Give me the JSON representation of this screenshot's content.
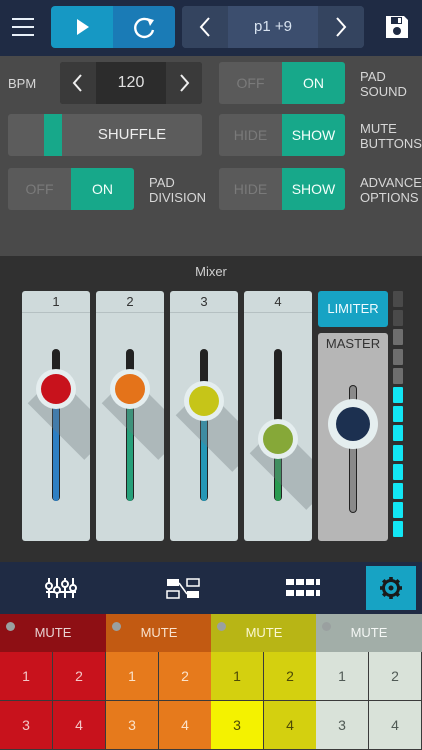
{
  "topbar": {
    "preset_name": "p1 +9",
    "menu_icon": "hamburger-menu-icon",
    "play_icon": "play-icon",
    "repeat_icon": "repeat-icon",
    "prev_icon": "chevron-left-icon",
    "next_icon": "chevron-right-icon",
    "save_icon": "floppy-disk-icon"
  },
  "settings": {
    "bpm_label": "BPM",
    "bpm_value": "120",
    "shuffle_label": "SHUFFLE",
    "shuffle_amount": 0.2,
    "pad_division": {
      "label_line1": "PAD",
      "label_line2": "DIVISION",
      "off": "OFF",
      "on": "ON",
      "value": "ON"
    },
    "pad_sound": {
      "label_line1": "PAD",
      "label_line2": "SOUND",
      "off": "OFF",
      "on": "ON",
      "value": "ON"
    },
    "mute_buttons": {
      "label_line1": "MUTE",
      "label_line2": "BUTTONS",
      "off": "HIDE",
      "on": "SHOW",
      "value": "SHOW"
    },
    "advanced_options": {
      "label_line1": "ADVANCED",
      "label_line2": "OPTIONS",
      "off": "HIDE",
      "on": "SHOW",
      "value": "SHOW"
    }
  },
  "mixer": {
    "title": "Mixer",
    "channels": [
      {
        "label": "1",
        "level": 0.88,
        "color": "#c8121c",
        "fill": "#2d7fc3"
      },
      {
        "label": "2",
        "level": 0.88,
        "color": "#e4731a",
        "fill": "#27a07a"
      },
      {
        "label": "3",
        "level": 0.8,
        "color": "#c6c518",
        "fill": "#2597b6"
      },
      {
        "label": "4",
        "level": 0.55,
        "color": "#86a838",
        "fill": "#2a9a50"
      }
    ],
    "limiter_label": "LIMITER",
    "master_label": "MASTER",
    "master_level": 0.85,
    "master_color": "#1c3050",
    "vu_level": 0.6
  },
  "tabs": [
    {
      "name": "mixer-tab",
      "icon": "sliders-icon",
      "active": false
    },
    {
      "name": "sequence-tab",
      "icon": "sequence-icon",
      "active": false
    },
    {
      "name": "pattern-tab",
      "icon": "pattern-grid-icon",
      "active": false
    },
    {
      "name": "settings-tab",
      "icon": "gear-icon",
      "active": true
    }
  ],
  "pads": {
    "mute_label": "MUTE",
    "columns": [
      {
        "mute_bg": "#8e0f14",
        "mute_fg": "#e8d2d2",
        "pad_bg": "#c8121c",
        "pad_bg_lit": "#c8121c",
        "pad_fg": "#f3c7c7",
        "pads": [
          "1",
          "2",
          "3",
          "4"
        ]
      },
      {
        "mute_bg": "#c25a12",
        "mute_fg": "#f9e2cd",
        "pad_bg": "#e67a1c",
        "pad_bg_lit": "#e67a1c",
        "pad_fg": "#fbe3cb",
        "pads": [
          "1",
          "2",
          "3",
          "4"
        ]
      },
      {
        "mute_bg": "#b8b515",
        "mute_fg": "#fbf8d2",
        "pad_bg": "#d4d00f",
        "pad_bg_lit": "#f4f200",
        "pad_fg": "#4d4a06",
        "pads": [
          "1",
          "2",
          "3",
          "4"
        ]
      },
      {
        "mute_bg": "#a2aea8",
        "mute_fg": "#f4f7f5",
        "pad_bg": "#d9e2d9",
        "pad_bg_lit": "#d9e2d9",
        "pad_fg": "#505a55",
        "pads": [
          "1",
          "2",
          "3",
          "4"
        ]
      }
    ]
  }
}
